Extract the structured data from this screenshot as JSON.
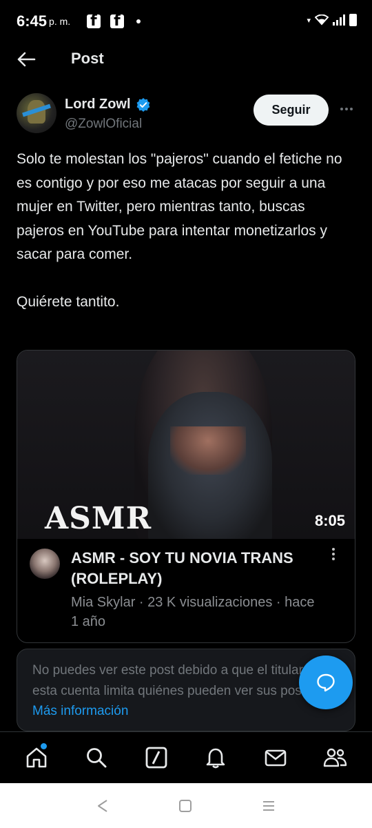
{
  "status_bar": {
    "time": "6:45",
    "ampm": "p. m."
  },
  "header": {
    "title": "Post"
  },
  "author": {
    "name": "Lord Zowl",
    "handle": "@ZowlOficial",
    "follow_label": "Seguir"
  },
  "post": {
    "text": "Solo te molestan los \"pajeros\" cuando el fetiche no es contigo y por eso me atacas por seguir a una mujer en Twitter, pero mientras tanto, buscas pajeros en YouTube para intentar monetizarlos y sacar para comer.\n\nQuiérete tantito."
  },
  "video_card": {
    "thumbnail_text": "ASMR",
    "duration": "8:05",
    "title": "ASMR - SOY TU NOVIA TRANS (ROLEPLAY)",
    "meta": "Mia Skylar · 23 K visualizaciones · hace 1 año"
  },
  "notice": {
    "text": "No puedes ver este post debido a que el titular de esta cuenta limita quiénes pueden ver sus posts. ",
    "link": "Más información"
  },
  "colors": {
    "accent": "#1d9bf0",
    "background": "#000000",
    "text_primary": "#e7e9ea",
    "text_secondary": "#71767b"
  },
  "icons": {
    "nav": [
      "home-icon",
      "search-icon",
      "grok-icon",
      "notifications-icon",
      "messages-icon",
      "communities-icon"
    ],
    "system": [
      "back-triangle-icon",
      "home-square-icon",
      "recents-icon"
    ]
  }
}
